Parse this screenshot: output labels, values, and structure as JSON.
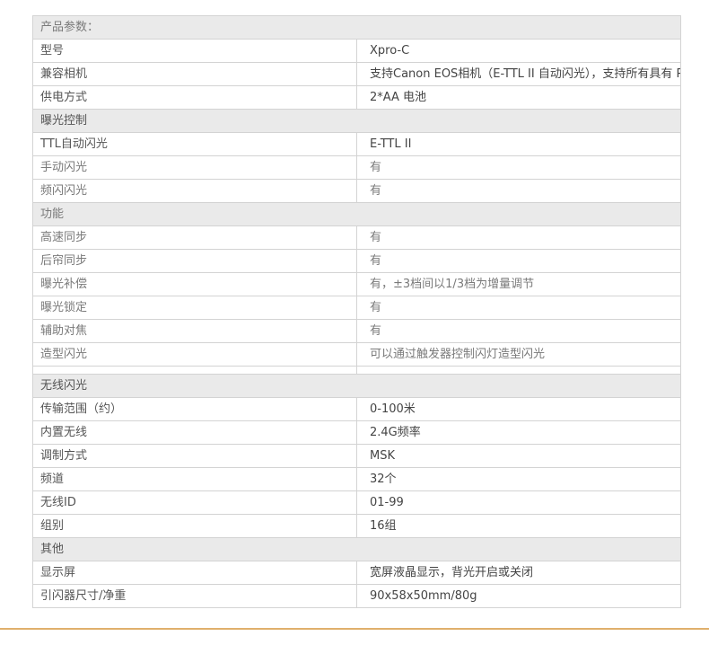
{
  "sections": {
    "s1": "产品参数：",
    "s2": "曝光控制",
    "s3": "功能",
    "s4": "无线闪光",
    "s5": "其他"
  },
  "rows": {
    "model": {
      "label": "型号",
      "value": "Xpro-C"
    },
    "camera": {
      "label": "兼容相机",
      "value": "支持Canon EOS相机（E-TTL II 自动闪光），支持所有具有 PC 输出口的相机"
    },
    "power": {
      "label": "供电方式",
      "value": "2*AA 电池"
    },
    "ttl": {
      "label": "TTL自动闪光",
      "value": "E-TTL II"
    },
    "manual": {
      "label": "手动闪光",
      "value": "有"
    },
    "multi": {
      "label": "频闪闪光",
      "value": "有"
    },
    "hss": {
      "label": "高速同步",
      "value": "有"
    },
    "rear": {
      "label": "后帘同步",
      "value": "有"
    },
    "comp": {
      "label": "曝光补偿",
      "value": "有，±3档间以1/3档为增量调节"
    },
    "lock": {
      "label": "曝光锁定",
      "value": "有"
    },
    "af": {
      "label": "辅助对焦",
      "value": "有"
    },
    "model_flash": {
      "label": "造型闪光",
      "value": "可以通过触发器控制闪灯造型闪光"
    },
    "range": {
      "label": "传输范围（约）",
      "value": "0-100米"
    },
    "antenna": {
      "label": "内置无线",
      "value": "2.4G频率"
    },
    "modulation": {
      "label": "调制方式",
      "value": "MSK"
    },
    "channel": {
      "label": "频道",
      "value": "32个"
    },
    "id": {
      "label": "无线ID",
      "value": "01-99"
    },
    "group": {
      "label": "组别",
      "value": "16组"
    },
    "display": {
      "label": "显示屏",
      "value": "宽屏液晶显示，背光开启或关闭"
    },
    "size": {
      "label": "引闪器尺寸/净重",
      "value": "90x58x50mm/80g"
    }
  },
  "colors": {
    "accent_rule": "#e0b06c",
    "section_bg": "#eaeaea",
    "border": "#d3d3d3"
  }
}
